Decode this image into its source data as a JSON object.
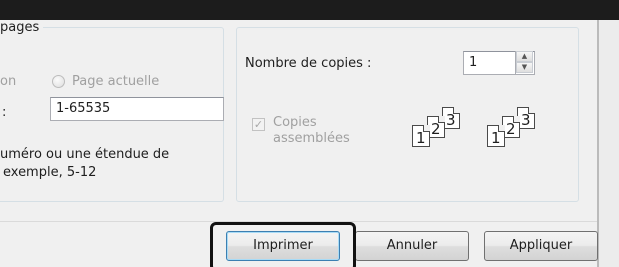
{
  "page_range_group": {
    "title": "pages",
    "radio_selection_label": "on",
    "radio_current_page_label": "Page actuelle",
    "pages_label_fragment": ":",
    "pages_value": "1-65535",
    "hint_line1": "uméro ou une étendue de",
    "hint_line2": "exemple, 5-12"
  },
  "copies_group": {
    "copies_label": "Nombre de copies :",
    "copies_value": "1",
    "collate_label_line1": "Copies",
    "collate_label_line2": "assemblées",
    "collate_checked": true,
    "spin_up_icon": "▲",
    "spin_down_icon": "▼",
    "collate_check_icon": "✓",
    "collated_icon_set_a": [
      "1",
      "2",
      "3"
    ],
    "collated_icon_set_b": [
      "1",
      "2",
      "3"
    ]
  },
  "buttons": {
    "print": "Imprimer",
    "cancel": "Annuler",
    "apply": "Appliquer"
  },
  "colors": {
    "disabled_text": "#a0a0a0",
    "highlight_border": "#111111",
    "topbar": "#1c1c1c"
  }
}
